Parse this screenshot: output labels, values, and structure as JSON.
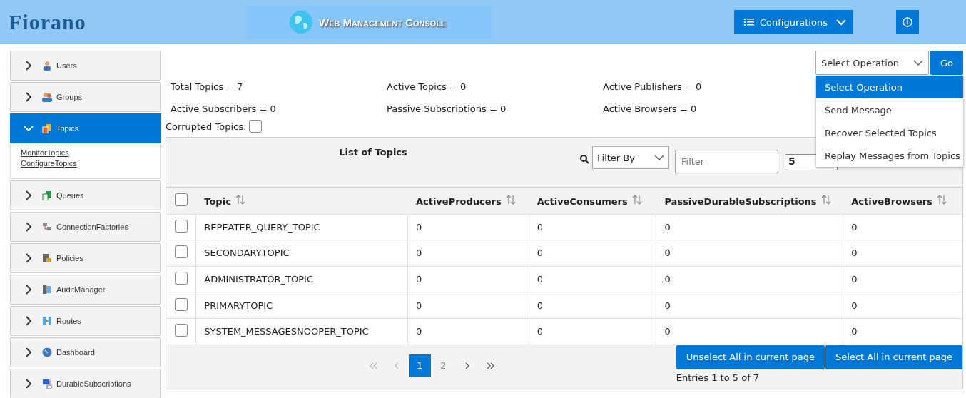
{
  "header": {
    "logo": "Fiorano",
    "banner": "Web Management Console",
    "configurations": "Configurations"
  },
  "sidebar": {
    "items": [
      {
        "label": "Users",
        "expanded": false
      },
      {
        "label": "Groups",
        "expanded": false
      },
      {
        "label": "Topics",
        "expanded": true,
        "children": [
          {
            "label": "MonitorTopics"
          },
          {
            "label": "ConfigureTopics"
          }
        ]
      },
      {
        "label": "Queues",
        "expanded": false
      },
      {
        "label": "ConnectionFactories",
        "expanded": false
      },
      {
        "label": "Policies",
        "expanded": false
      },
      {
        "label": "AuditManager",
        "expanded": false
      },
      {
        "label": "Routes",
        "expanded": false
      },
      {
        "label": "Dashboard",
        "expanded": false
      },
      {
        "label": "DurableSubscriptions",
        "expanded": false
      }
    ]
  },
  "operation": {
    "value": "Select Operation",
    "go": "Go",
    "options": [
      {
        "label": "Select Operation",
        "selected": true
      },
      {
        "label": "Send Message",
        "selected": false
      },
      {
        "label": "Recover Selected Topics",
        "selected": false
      },
      {
        "label": "Replay Messages from Topics",
        "selected": false
      }
    ]
  },
  "stats": [
    "Total Topics = 7",
    "Active Topics = 0",
    "Active Publishers = 0",
    "Active Subscribers = 0",
    "Passive Subscriptions = 0",
    "Active Browsers = 0"
  ],
  "corrupted": {
    "label": "Corrupted Topics:",
    "checked": false
  },
  "table": {
    "title": "List of Topics",
    "filter_by": "Filter By",
    "filter_placeholder": "Filter",
    "page_size": "5",
    "all_checked": false,
    "columns": [
      "Topic",
      "ActiveProducers",
      "ActiveConsumers",
      "PassiveDurableSubscriptions",
      "ActiveBrowsers"
    ],
    "rows": [
      {
        "checked": false,
        "cells": [
          "REPEATER_QUERY_TOPIC",
          "0",
          "0",
          "0",
          "0"
        ]
      },
      {
        "checked": false,
        "cells": [
          "SECONDARYTOPIC",
          "0",
          "0",
          "0",
          "0"
        ]
      },
      {
        "checked": false,
        "cells": [
          "ADMINISTRATOR_TOPIC",
          "0",
          "0",
          "0",
          "0"
        ]
      },
      {
        "checked": false,
        "cells": [
          "PRIMARYTOPIC",
          "0",
          "0",
          "0",
          "0"
        ]
      },
      {
        "checked": false,
        "cells": [
          "SYSTEM_MESSAGESNOOPER_TOPIC",
          "0",
          "0",
          "0",
          "0"
        ]
      }
    ]
  },
  "pagination": {
    "pages": [
      {
        "label": "1",
        "selected": true
      },
      {
        "label": "2",
        "selected": false
      }
    ],
    "buttons": [
      "Unselect All in current page",
      "Select All in current page"
    ],
    "entries": "Entries 1 to 5 of 7"
  }
}
